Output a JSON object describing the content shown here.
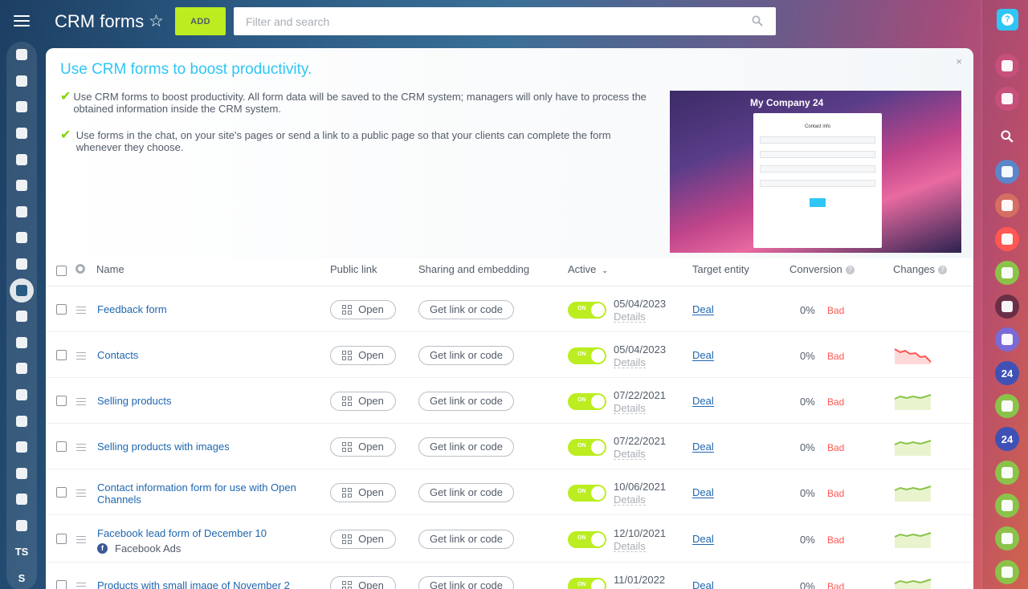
{
  "header": {
    "title": "CRM forms",
    "add_label": "ADD",
    "search_placeholder": "Filter and search"
  },
  "left_nav": {
    "items": [
      {
        "name": "left-nav-sites-icon"
      },
      {
        "name": "left-nav-feed-icon"
      },
      {
        "name": "left-nav-chat-icon"
      },
      {
        "name": "left-nav-calendar-icon"
      },
      {
        "name": "left-nav-docs-icon"
      },
      {
        "name": "left-nav-inbox-icon"
      },
      {
        "name": "left-nav-mail-icon"
      },
      {
        "name": "left-nav-groups-icon"
      },
      {
        "name": "left-nav-tasks-icon"
      },
      {
        "name": "left-nav-crm-icon",
        "active": true
      },
      {
        "name": "left-nav-store-icon"
      },
      {
        "name": "left-nav-marketing-icon"
      },
      {
        "name": "left-nav-shop-icon"
      },
      {
        "name": "left-nav-sign-icon"
      },
      {
        "name": "left-nav-contact-card-icon"
      },
      {
        "name": "left-nav-robot-icon"
      },
      {
        "name": "left-nav-box-icon"
      },
      {
        "name": "left-nav-automation-icon"
      },
      {
        "name": "left-nav-devops-icon"
      }
    ],
    "ts_label": "TS",
    "s_label": "S"
  },
  "banner": {
    "title": "Use CRM forms to boost productivity.",
    "close": "×",
    "bullets": [
      "Use CRM forms to boost productivity. All form data will be saved to the CRM system; managers will only have to process the obtained information inside the CRM system.",
      "Use forms in the chat, on your site's pages or send a link to a public page so that your clients can complete the form whenever they choose."
    ],
    "preview_brand": "My Company 24",
    "preview_form_title": "Contact info"
  },
  "table": {
    "headers": {
      "name": "Name",
      "public_link": "Public link",
      "sharing": "Sharing and embedding",
      "active": "Active",
      "target": "Target entity",
      "conversion": "Conversion",
      "changes": "Changes"
    },
    "open_label": "Open",
    "share_label": "Get link or code",
    "toggle_label": "ON",
    "details_label": "Details",
    "rows": [
      {
        "name": "Feedback form",
        "date": "05/04/2023",
        "target": "Deal",
        "conversion": "0%",
        "status": "Bad",
        "trend": "none"
      },
      {
        "name": "Contacts",
        "date": "05/04/2023",
        "target": "Deal",
        "conversion": "0%",
        "status": "Bad",
        "trend": "down"
      },
      {
        "name": "Selling products",
        "date": "07/22/2021",
        "target": "Deal",
        "conversion": "0%",
        "status": "Bad",
        "trend": "flat"
      },
      {
        "name": "Selling products with images",
        "date": "07/22/2021",
        "target": "Deal",
        "conversion": "0%",
        "status": "Bad",
        "trend": "flat"
      },
      {
        "name": "Contact information form for use with Open Channels",
        "date": "10/06/2021",
        "target": "Deal",
        "conversion": "0%",
        "status": "Bad",
        "trend": "flat"
      },
      {
        "name": "Facebook lead form of December 10",
        "sub": "Facebook Ads",
        "date": "12/10/2021",
        "target": "Deal",
        "conversion": "0%",
        "status": "Bad",
        "trend": "flat"
      },
      {
        "name": "Products with small image of November 2",
        "date": "11/01/2022",
        "target": "Deal",
        "conversion": "0%",
        "status": "Bad",
        "trend": "flat"
      }
    ]
  },
  "right_bar": {
    "items": [
      {
        "name": "notifications-bell-icon",
        "color": "#c7507a"
      },
      {
        "name": "messenger-chat-icon",
        "color": "#c7507a"
      },
      {
        "name": "search-icon",
        "color": "transparent"
      },
      {
        "name": "calendar-chat-icon",
        "color": "#5b86c9"
      },
      {
        "name": "contact-card-chat-icon",
        "color": "#d46f62"
      },
      {
        "name": "lock-chat-icon",
        "color": "#ff5752"
      },
      {
        "name": "user-avatar-icon",
        "color": "#8bc34a"
      },
      {
        "name": "user-photo-avatar-icon",
        "color": "#6a2f46"
      },
      {
        "name": "group-chat-icon",
        "color": "#7b6ad6"
      },
      {
        "name": "bitrix24-chat-icon",
        "color": "#3f51b5",
        "label": "24"
      },
      {
        "name": "lock-green-chat-icon",
        "color": "#8bc34a"
      },
      {
        "name": "bitrix24-chat-icon-2",
        "color": "#3f51b5",
        "label": "24"
      },
      {
        "name": "group-avatar-icon-1",
        "color": "#8bc34a"
      },
      {
        "name": "group-avatar-icon-2",
        "color": "#8bc34a"
      },
      {
        "name": "group-avatar-icon-3",
        "color": "#8bc34a"
      },
      {
        "name": "group-avatar-icon-4",
        "color": "#8bc34a"
      }
    ]
  },
  "colors": {
    "accent_green": "#bbed21",
    "link_blue": "#2067b0",
    "banner_blue": "#2fc6f6",
    "bad_red": "#ff5752"
  }
}
